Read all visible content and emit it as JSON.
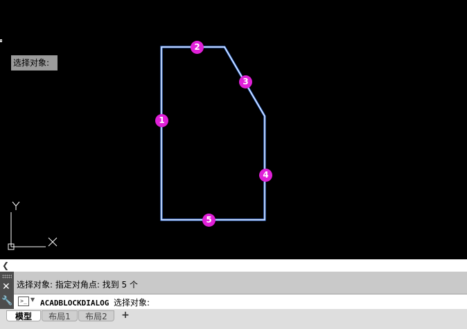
{
  "viewport": {
    "tooltip": "选择对象:",
    "ucs": {
      "x_label": "X",
      "y_label": "Y"
    },
    "markers": [
      "1",
      "2",
      "3",
      "4",
      "5"
    ],
    "colors": {
      "background": "#000000",
      "outline": "#ffffff",
      "glow": "#4a8cff",
      "marker": "#e020d8"
    }
  },
  "command_line": {
    "history": "选择对象: 指定对角点: 找到 5 个",
    "prompt_icon": ">_",
    "command": "ACADBLOCKDIALOG",
    "prompt": "选择对象:"
  },
  "tabs": {
    "items": [
      "模型",
      "布局1",
      "布局2"
    ],
    "add": "+",
    "active": "模型"
  }
}
